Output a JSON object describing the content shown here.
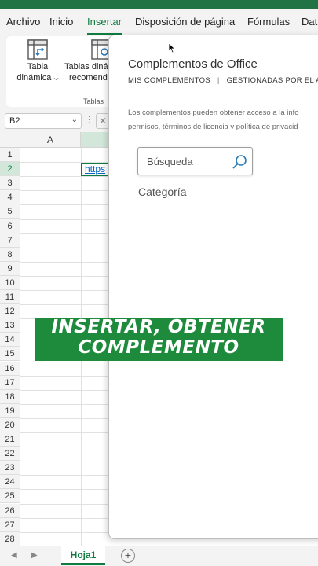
{
  "menu": {
    "items": [
      "Archivo",
      "Inicio",
      "Insertar",
      "Disposición de página",
      "Fórmulas",
      "Dat"
    ],
    "active": "Insertar"
  },
  "ribbon": {
    "pivot_table_line1": "Tabla",
    "pivot_table_line2": "dinámica",
    "recommended_line1": "Tablas diná",
    "recommended_line2": "recomend",
    "group_label": "Tablas"
  },
  "formula_bar": {
    "name_box": "B2"
  },
  "grid": {
    "columns": [
      "A"
    ],
    "rows": [
      "1",
      "2",
      "3",
      "4",
      "5",
      "6",
      "7",
      "8",
      "9",
      "10",
      "11",
      "12",
      "13",
      "14",
      "15",
      "16",
      "17",
      "18",
      "19",
      "20",
      "21",
      "22",
      "23",
      "24",
      "25",
      "26",
      "27",
      "28"
    ],
    "active_cell_text": "https"
  },
  "sheets": {
    "tabs": [
      "Hoja1"
    ],
    "add_symbol": "+"
  },
  "dialog": {
    "title": "Complementos de Office",
    "tab_mine": "MIS COMPLEMENTOS",
    "tab_separator": "|",
    "tab_managed": "GESTIONADAS POR EL ADM",
    "desc_line1": "Los complementos pueden obtener acceso a la info",
    "desc_line2": "permisos, términos de licencia y política de privacid",
    "search_placeholder": "Búsqueda",
    "category_label": "Categoría"
  },
  "overlay": {
    "line1": "INSERTAR, OBTENER",
    "line2": "COMPLEMENTO"
  },
  "colors": {
    "accent": "#107c41",
    "brand_bar": "#217346",
    "overlay_bg": "#1e8a3c"
  }
}
